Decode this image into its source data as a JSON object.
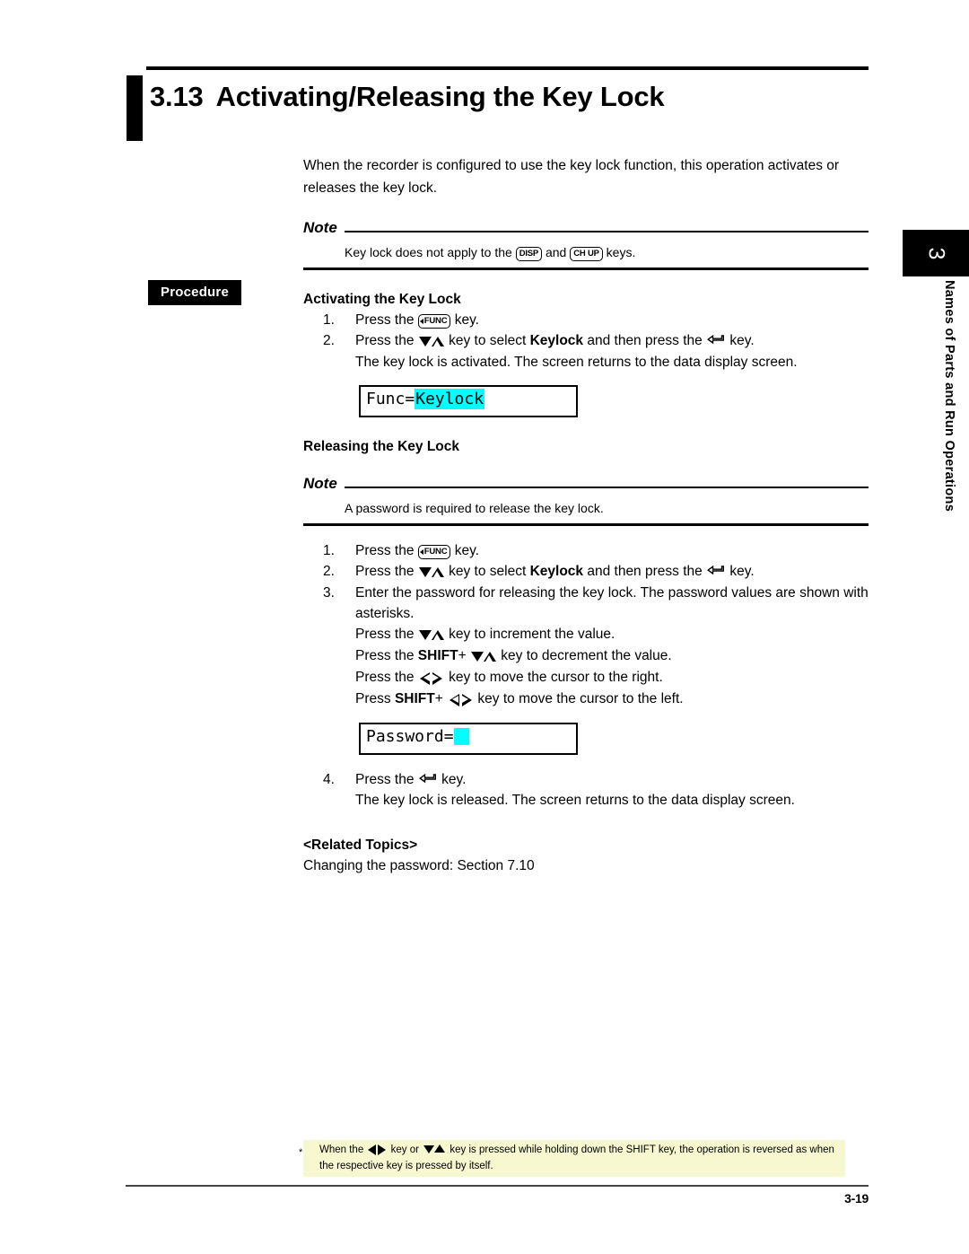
{
  "page": {
    "section_number": "3.13",
    "title": "Activating/Releasing the Key Lock",
    "page_number": "3-19"
  },
  "chapter_tab": {
    "number": "3",
    "title": "Names of Parts and Run Operations"
  },
  "intro": "When the recorder is configured to use the key lock function, this operation activates or releases the key lock.",
  "note_top": {
    "label": "Note",
    "text_before": "Key lock does not apply to the",
    "key_1": "DISP",
    "text_middle": "and",
    "key_2": "CH UP",
    "text_after": "keys."
  },
  "procedure_badge": "Procedure",
  "activating": {
    "heading": "Activating the Key Lock",
    "steps": [
      {
        "num": "1.",
        "pre": "Press the",
        "key": "FUNC",
        "post": "key."
      },
      {
        "num": "2.",
        "pre": "Press the",
        "glyph_1": "up-down-arrow-key",
        "mid_1": "key to select",
        "bold": "Keylock",
        "mid_2": "and then press the",
        "glyph_2": "enter-key",
        "post": "key.",
        "continuation": "The key lock is activated.  The screen returns to the data display screen."
      }
    ],
    "lcd": {
      "label": "Func=",
      "highlighted": "Keylock"
    }
  },
  "releasing": {
    "heading": "Releasing the Key Lock",
    "note": {
      "label": "Note",
      "text": "A password is required to release the key lock."
    },
    "steps": [
      {
        "num": "1.",
        "pre": "Press the",
        "key": "FUNC",
        "post": "key."
      },
      {
        "num": "2.",
        "pre": "Press the",
        "mid_1": "key to select",
        "bold": "Keylock",
        "mid_2": "and then press the",
        "post": "key."
      },
      {
        "num": "3.",
        "text": "Enter the password for releasing the key lock.  The password values are shown with asterisks.",
        "sub_lines": [
          {
            "pre": "Press the",
            "glyph": "up-down-arrow-key",
            "post": "key to increment the value."
          },
          {
            "pre": "Press the",
            "bold": "SHIFT",
            "plus": "+",
            "glyph": "up-down-arrow-key",
            "post": "key to decrement the value."
          },
          {
            "pre": "Press the",
            "glyph": "left-right-arrow-key",
            "post": "key to move the cursor to the right."
          },
          {
            "pre": "Press",
            "bold": "SHIFT",
            "plus": "+",
            "glyph": "left-right-arrow-key",
            "post": "key to move the cursor to the left."
          }
        ]
      },
      {
        "num": "4.",
        "pre": "Press the",
        "glyph": "enter-key",
        "post": "key.",
        "continuation": "The key lock is released.  The screen returns to the data display screen."
      }
    ],
    "lcd": {
      "label": "Password=",
      "cursor": ""
    }
  },
  "related_topics": {
    "heading": "<Related Topics>",
    "text": "Changing the password: Section 7.10"
  },
  "footnote": {
    "marker": "*",
    "line1_a": "When the",
    "line1_b": "key or",
    "line1_c": "key is pressed while holding down the SHIFT key, the operation is",
    "line2": "reversed as when the respective key is pressed by itself."
  },
  "colors": {
    "lcd_highlight": "#00ffff",
    "footnote_background": "#f7f8cf",
    "ink": "#000000"
  }
}
